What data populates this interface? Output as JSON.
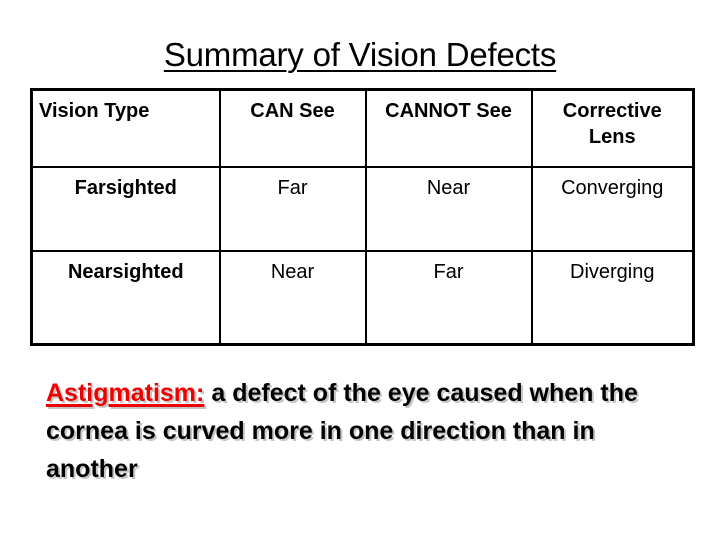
{
  "slide": {
    "title": "Summary of Vision Defects"
  },
  "table": {
    "headers": [
      "Vision Type",
      "CAN See",
      "CANNOT See",
      "Corrective Lens"
    ],
    "rows": [
      {
        "vision_type": "Farsighted",
        "can_see": "Far",
        "cannot_see": "Near",
        "corrective_lens": "Converging"
      },
      {
        "vision_type": "Nearsighted",
        "can_see": "Near",
        "cannot_see": "Far",
        "corrective_lens": "Diverging"
      }
    ]
  },
  "definition": {
    "term": "Astigmatism:",
    "text": "a defect of the eye caused when the cornea is curved more in one direction than in another"
  },
  "colors": {
    "term_red": "#ee0000",
    "text_black": "#000000",
    "border_black": "#000000",
    "background": "#ffffff"
  }
}
